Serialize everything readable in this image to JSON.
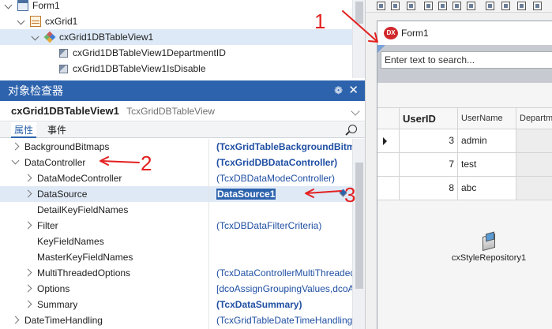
{
  "structure_tree": {
    "items": [
      {
        "label": "Form1",
        "indent": 0,
        "icon": "form-icon"
      },
      {
        "label": "cxGrid1",
        "indent": 1,
        "icon": "grid-icon"
      },
      {
        "label": "cxGrid1DBTableView1",
        "indent": 2,
        "icon": "tableview-icon"
      },
      {
        "label": "cxGrid1DBTableView1DepartmentID",
        "indent": 3,
        "icon": "column-icon"
      },
      {
        "label": "cxGrid1DBTableView1IsDisable",
        "indent": 3,
        "icon": "column-icon"
      }
    ]
  },
  "object_inspector": {
    "title": "对象检查器",
    "pin_glyph": "❁",
    "close_glyph": "✕",
    "selected_object": "cxGrid1DBTableView1",
    "selected_class": "TcxGridDBTableView",
    "tabs": [
      "属性",
      "事件"
    ],
    "active_tab": 0,
    "properties": [
      {
        "name": "BackgroundBitmaps",
        "value": "(TcxGridTableBackgroundBitmaps)",
        "level": 0,
        "expander": "right",
        "bold": true
      },
      {
        "name": "DataController",
        "value": "(TcxGridDBDataController)",
        "level": 0,
        "expander": "down",
        "bold": true
      },
      {
        "name": "DataModeController",
        "value": "(TcxDBDataModeController)",
        "level": 1,
        "expander": "right",
        "bold": false
      },
      {
        "name": "DataSource",
        "value": "DataSource1",
        "level": 1,
        "expander": "right",
        "bold": true,
        "active": true
      },
      {
        "name": "DetailKeyFieldNames",
        "value": "",
        "level": 1,
        "expander": "none",
        "bold": false
      },
      {
        "name": "Filter",
        "value": "(TcxDBDataFilterCriteria)",
        "level": 1,
        "expander": "right",
        "bold": false
      },
      {
        "name": "KeyFieldNames",
        "value": "",
        "level": 1,
        "expander": "none",
        "bold": false
      },
      {
        "name": "MasterKeyFieldNames",
        "value": "",
        "level": 1,
        "expander": "none",
        "bold": false
      },
      {
        "name": "MultiThreadedOptions",
        "value": "(TcxDataControllerMultiThreadedOptions)",
        "level": 1,
        "expander": "right",
        "bold": false
      },
      {
        "name": "Options",
        "value": "[dcoAssignGroupingValues,dcoAssignMasterDetailKeys]",
        "level": 1,
        "expander": "right",
        "bold": false
      },
      {
        "name": "Summary",
        "value": "(TcxDataSummary)",
        "level": 1,
        "expander": "right",
        "bold": true
      },
      {
        "name": "DateTimeHandling",
        "value": "(TcxGridTableDateTimeHandling)",
        "level": 0,
        "expander": "right",
        "bold": false
      }
    ]
  },
  "designer": {
    "form_caption": "Form1",
    "logo_text": "DX",
    "find_placeholder": "Enter text to search...",
    "grid": {
      "columns": [
        "UserID",
        "UserName",
        "Department"
      ],
      "rows": [
        {
          "UserID": "3",
          "UserName": "admin",
          "current": true
        },
        {
          "UserID": "7",
          "UserName": "test",
          "current": false
        },
        {
          "UserID": "8",
          "UserName": "abc",
          "current": false
        }
      ]
    },
    "style_repository_label": "cxStyleRepository1"
  },
  "annotations": {
    "labels": [
      "1",
      "2",
      "3"
    ],
    "color": "#e32020"
  },
  "colors": {
    "inspector_header": "#2d63ad",
    "value_text": "#1f4fa3",
    "selection": "#dde9f6",
    "find_panel": "#c7cbd1"
  }
}
